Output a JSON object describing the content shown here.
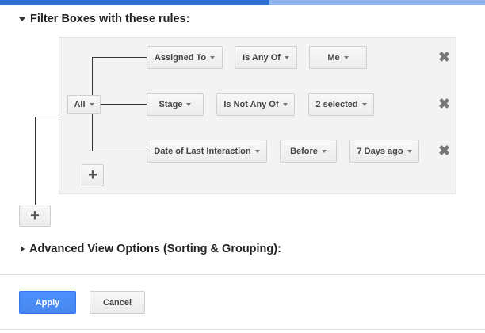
{
  "filter_section": {
    "title": "Filter Boxes with these rules:"
  },
  "combinator": {
    "label": "All"
  },
  "rules": [
    {
      "field": "Assigned To",
      "operator": "Is Any Of",
      "value": "Me"
    },
    {
      "field": "Stage",
      "operator": "Is Not Any Of",
      "value": "2 selected"
    },
    {
      "field": "Date of Last Interaction",
      "operator": "Before",
      "value": "7 Days ago"
    }
  ],
  "advanced_section": {
    "title": "Advanced View Options (Sorting & Grouping):"
  },
  "buttons": {
    "add_rule_icon": "plus-icon",
    "add_group_icon": "plus-icon",
    "remove_icon": "close-icon",
    "apply": "Apply",
    "cancel": "Cancel"
  },
  "colors": {
    "primary": "#4d90fe",
    "accent_bar": "#2f6fd8"
  }
}
